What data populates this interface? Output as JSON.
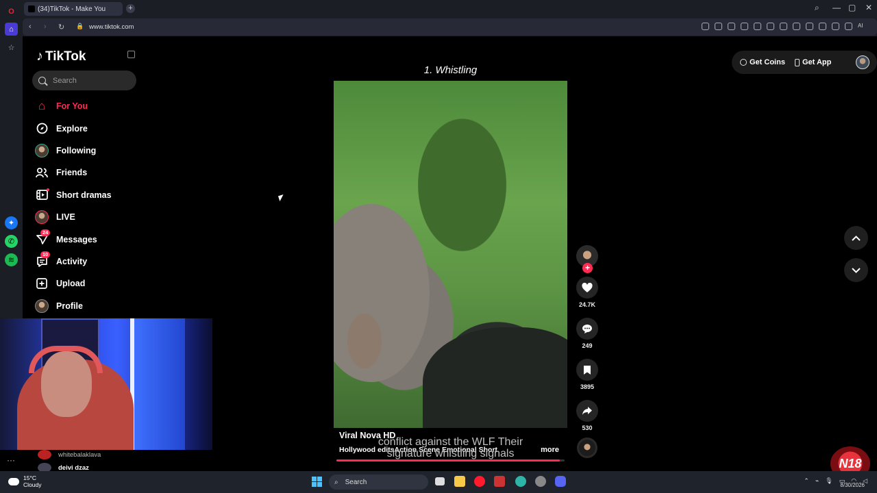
{
  "browser": {
    "tab_title": "(34)TikTok - Make You",
    "url": "www.tiktok.com",
    "ai_label": "AI"
  },
  "tiktok": {
    "logo": "TikTok",
    "search_placeholder": "Search",
    "nav": [
      {
        "label": "For You",
        "icon": "home-icon",
        "active": true
      },
      {
        "label": "Explore",
        "icon": "compass-icon"
      },
      {
        "label": "Following",
        "icon": "following-avatar"
      },
      {
        "label": "Friends",
        "icon": "friends-icon"
      },
      {
        "label": "Short dramas",
        "icon": "film-icon"
      },
      {
        "label": "LIVE",
        "icon": "live-avatar"
      },
      {
        "label": "Messages",
        "icon": "messages-icon",
        "badge": "24"
      },
      {
        "label": "Activity",
        "icon": "activity-icon",
        "badge": "10"
      },
      {
        "label": "Upload",
        "icon": "upload-icon"
      },
      {
        "label": "Profile",
        "icon": "profile-avatar"
      }
    ],
    "top_right": {
      "coins": "Get Coins",
      "app": "Get App"
    },
    "video": {
      "title": "1. Whistling",
      "author": "Viral Nova HD",
      "description": "Hollywood editsAction Scene Emotional Short",
      "subtitle_line1": "conflict against the WLF Their",
      "subtitle_line2": "signature whistling signals",
      "more": "more",
      "progress": 0.98
    },
    "actions": {
      "likes": "24.7K",
      "comments": "249",
      "saves": "3895",
      "shares": "530"
    }
  },
  "chat": {
    "user1": "whitebalaklava",
    "user2": "deivi dzaz"
  },
  "taskbar": {
    "temp": "15°C",
    "weather": "Cloudy",
    "search": "Search",
    "date": "8/30/2026"
  },
  "colors": {
    "accent": "#fe2c55"
  }
}
